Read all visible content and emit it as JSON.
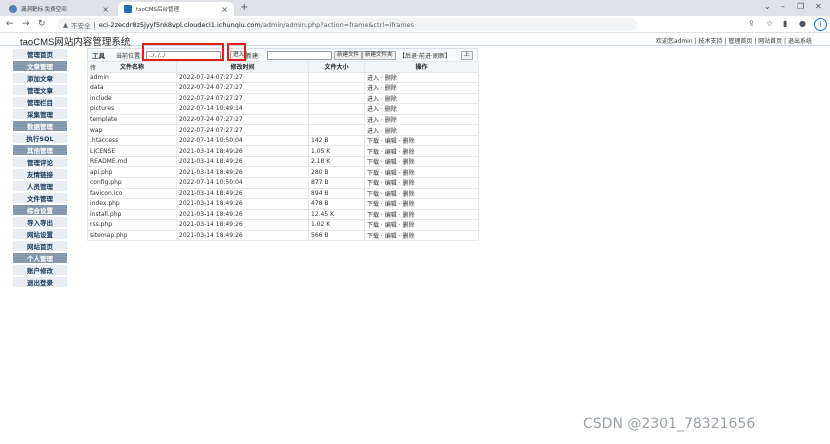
{
  "browser": {
    "tabs": [
      {
        "title": "漏洞靶标·免费空间",
        "active": false
      },
      {
        "title": "taoCMS后台管理",
        "active": true
      }
    ],
    "security_label": "不安全",
    "url_host": "eci-2zecdr8z5jyyf5nk8vpl.cloudeci1.ichunqiu.com",
    "url_path": "/admin/admin.php?action=frame&ctrl=iframes"
  },
  "app": {
    "title": "taoCMS网站内容管理系统",
    "top_links": "欢迎您admin | 技术支持 | 管理首页 | 网站首页 | 退出系统"
  },
  "sidebar": {
    "items": [
      {
        "label": "管理首页",
        "header": false
      },
      {
        "label": "文章管理",
        "header": true
      },
      {
        "label": "添加文章",
        "header": false
      },
      {
        "label": "管理文章",
        "header": false
      },
      {
        "label": "管理栏目",
        "header": false
      },
      {
        "label": "采集管理",
        "header": false
      },
      {
        "label": "数据管理",
        "header": true
      },
      {
        "label": "执行SQL",
        "header": false
      },
      {
        "label": "其他管理",
        "header": true
      },
      {
        "label": "管理评论",
        "header": false
      },
      {
        "label": "友情链接",
        "header": false
      },
      {
        "label": "人员管理",
        "header": false
      },
      {
        "label": "文件管理",
        "header": false
      },
      {
        "label": "综合设置",
        "header": true
      },
      {
        "label": "导入导出",
        "header": false
      },
      {
        "label": "网站设置",
        "header": false
      },
      {
        "label": "网站首页",
        "header": false
      },
      {
        "label": "个人管理",
        "header": true
      },
      {
        "label": "账户修改",
        "header": false
      },
      {
        "label": "退出登录",
        "header": false
      }
    ]
  },
  "toolbar": {
    "tool_label": "工具",
    "location_label": "当前位置:",
    "location_value": "../../../",
    "enter_button": "进入",
    "new_label": "新建:",
    "new_value": "",
    "new_file_button": "新建文件",
    "new_folder_button": "新建文件夹",
    "history_links": "【后退·前进·刷新】",
    "up_button": "上",
    "upload_fragment": "传"
  },
  "table": {
    "headers": [
      "文件名称",
      "修改时间",
      "文件大小",
      "操作"
    ],
    "rows": [
      {
        "name": "admin",
        "time": "2022-07-24 07:27:27",
        "size": "",
        "ops": "进入 · 删除"
      },
      {
        "name": "data",
        "time": "2022-07-24 07:27:27",
        "size": "",
        "ops": "进入 · 删除"
      },
      {
        "name": "include",
        "time": "2022-07-24 07:27:27",
        "size": "",
        "ops": "进入 · 删除"
      },
      {
        "name": "pictures",
        "time": "2022-07-14 10:49:14",
        "size": "",
        "ops": "进入 · 删除"
      },
      {
        "name": "template",
        "time": "2022-07-24 07:27:27",
        "size": "",
        "ops": "进入 · 删除"
      },
      {
        "name": "wap",
        "time": "2022-07-24 07:27:27",
        "size": "",
        "ops": "进入 · 删除"
      },
      {
        "name": ".htaccess",
        "time": "2022-07-14 10:50:04",
        "size": "142 B",
        "ops": "下载 · 编辑 · 删除"
      },
      {
        "name": "LICENSE",
        "time": "2021-03-14 18:49:26",
        "size": "1.05 K",
        "ops": "下载 · 编辑 · 删除"
      },
      {
        "name": "README.md",
        "time": "2021-03-14 18:49:26",
        "size": "2.18 K",
        "ops": "下载 · 编辑 · 删除"
      },
      {
        "name": "api.php",
        "time": "2021-03-14 18:49:26",
        "size": "280 B",
        "ops": "下载 · 编辑 · 删除"
      },
      {
        "name": "config.php",
        "time": "2022-07-14 10:50:04",
        "size": "877 B",
        "ops": "下载 · 编辑 · 删除"
      },
      {
        "name": "favicon.ico",
        "time": "2021-03-14 18:49:26",
        "size": "894 B",
        "ops": "下载 · 编辑 · 删除"
      },
      {
        "name": "index.php",
        "time": "2021-03-14 18:49:26",
        "size": "478 B",
        "ops": "下载 · 编辑 · 删除"
      },
      {
        "name": "install.php",
        "time": "2021-03-14 18:49:26",
        "size": "12.45 K",
        "ops": "下载 · 编辑 · 删除"
      },
      {
        "name": "rss.php",
        "time": "2021-03-14 18:49:26",
        "size": "1.02 K",
        "ops": "下载 · 编辑 · 删除"
      },
      {
        "name": "sitemap.php",
        "time": "2021-03-14 18:49:26",
        "size": "566 B",
        "ops": "下载 · 编辑 · 删除"
      }
    ]
  },
  "watermark": "CSDN @2301_78321656",
  "colors": {
    "highlight_box": "#e0201a",
    "sidebar_header": "#8599ad",
    "sidebar_item": "#e8eef4"
  }
}
